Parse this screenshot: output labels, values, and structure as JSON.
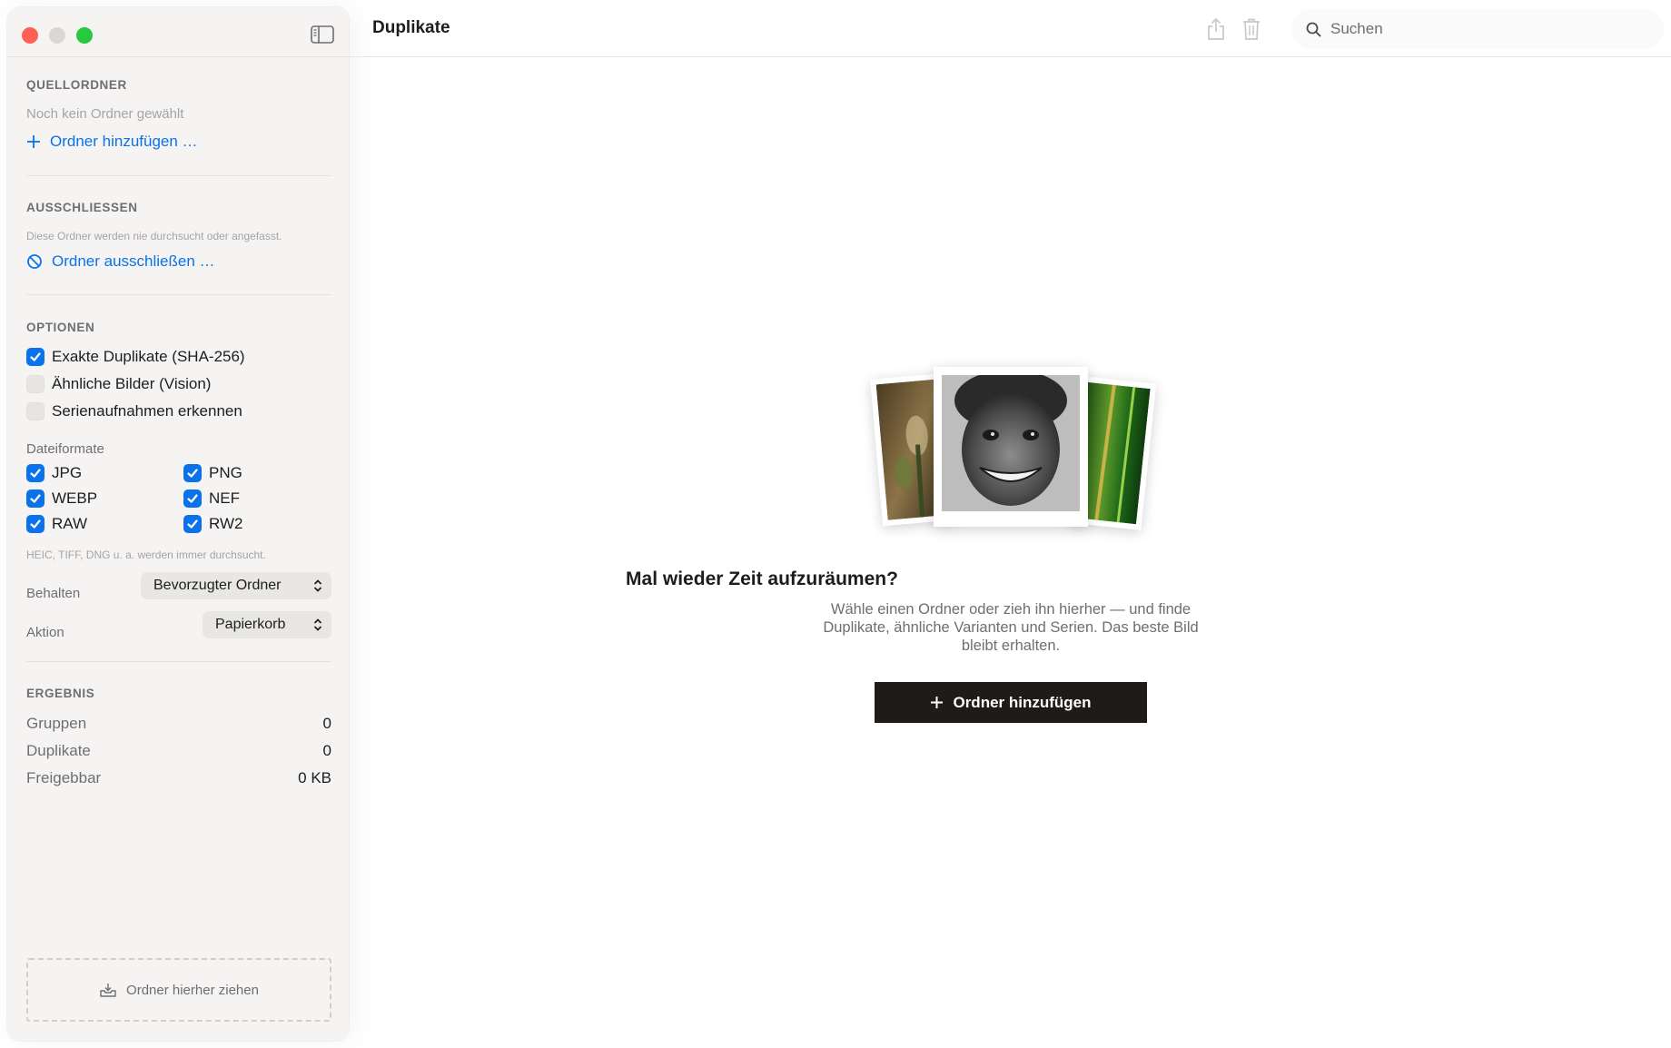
{
  "window": {
    "title": "Duplikate"
  },
  "toolbar": {
    "share_icon": "share-icon",
    "trash_icon": "trash-icon"
  },
  "search": {
    "placeholder": "Suchen",
    "value": ""
  },
  "sidebar": {
    "source": {
      "title": "QUELLORDNER",
      "empty_text": "Noch kein Ordner gewählt",
      "add_label": "Ordner hinzufügen …"
    },
    "exclude": {
      "title": "AUSSCHLIESSEN",
      "description": "Diese Ordner werden nie durchsucht oder angefasst.",
      "action_label": "Ordner ausschließen …"
    },
    "options": {
      "title": "OPTIONEN",
      "items": [
        {
          "label": "Exakte Duplikate (SHA-256)",
          "checked": true
        },
        {
          "label": "Ähnliche Bilder (Vision)",
          "checked": false
        },
        {
          "label": "Serienaufnahmen erkennen",
          "checked": false
        }
      ],
      "formats_label": "Dateiformate",
      "formats": [
        {
          "label": "JPG",
          "checked": true
        },
        {
          "label": "PNG",
          "checked": true
        },
        {
          "label": "WEBP",
          "checked": true
        },
        {
          "label": "NEF",
          "checked": true
        },
        {
          "label": "RAW",
          "checked": true
        },
        {
          "label": "RW2",
          "checked": true
        }
      ],
      "formats_note": "HEIC, TIFF, DNG u. a. werden immer durchsucht.",
      "keep_label": "Behalten",
      "keep_value": "Bevorzugter Ordner",
      "action_label": "Aktion",
      "action_value": "Papierkorb"
    },
    "result": {
      "title": "ERGEBNIS",
      "rows": [
        {
          "label": "Gruppen",
          "value": "0"
        },
        {
          "label": "Duplikate",
          "value": "0"
        },
        {
          "label": "Freigebbar",
          "value": "0 KB"
        }
      ]
    },
    "dropzone_label": "Ordner hierher ziehen"
  },
  "empty_state": {
    "headline": "Mal wieder Zeit aufzuräumen?",
    "description": "Wähle einen Ordner oder zieh ihn hierher — und finde Duplikate, ähnliche Varianten und Serien. Das beste Bild bleibt erhalten.",
    "button_label": "Ordner hinzufügen"
  },
  "colors": {
    "accent": "#0a72ea",
    "cta_background": "#1f1b18",
    "close": "#fe5f57",
    "zoom": "#28c840"
  }
}
